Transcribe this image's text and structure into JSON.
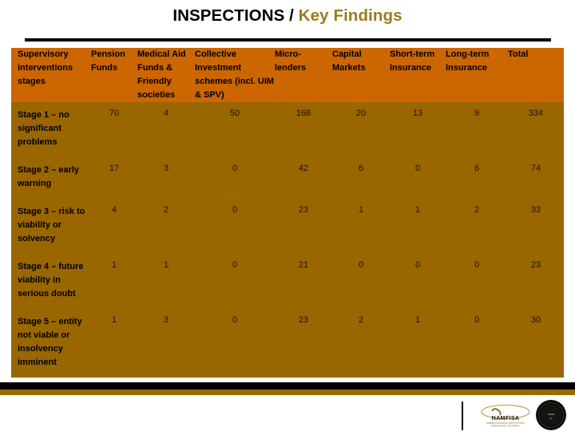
{
  "slide": {
    "title_primary": "INSPECTIONS / ",
    "title_secondary": "Key Findings",
    "accent_orange": "#CC6600",
    "accent_gold": "#996600",
    "title_gold": "#9A7B1E"
  },
  "table": {
    "headers": [
      "Supervisory interventions stages",
      "Pension Funds",
      "Medical Aid Funds & Friendly societies",
      "Collective Investment schemes (incl. UIM & SPV)",
      "Micro-lenders",
      "Capital Markets",
      "Short-term Insurance",
      "Long-term Insurance",
      "Total"
    ],
    "rows": [
      {
        "label": "Stage 1 – no significant problems",
        "values": [
          "70",
          "4",
          "50",
          "168",
          "20",
          "13",
          "9",
          "334"
        ]
      },
      {
        "label": "Stage 2 – early warning",
        "values": [
          "17",
          "3",
          "0",
          "42",
          "6",
          "0",
          "6",
          "74"
        ]
      },
      {
        "label": "Stage 3 – risk to viability or solvency",
        "values": [
          "4",
          "2",
          "0",
          "23",
          "1",
          "1",
          "2",
          "33"
        ]
      },
      {
        "label": "Stage 4 – future viability in serious doubt",
        "values": [
          "1",
          "1",
          "0",
          "21",
          "0",
          "0",
          "0",
          "23"
        ]
      },
      {
        "label": "Stage 5 – entity not viable or insolvency imminent",
        "values": [
          "1",
          "3",
          "0",
          "23",
          "2",
          "1",
          "0",
          "30"
        ]
      }
    ]
  },
  "footer": {
    "namfisa_wordmark": "NAMFISA",
    "namfisa_tagline": "NAMIBIA FINANCIAL INSTITUTIONS SUPERVISORY AUTHORITY",
    "seal_text": "Seal"
  }
}
